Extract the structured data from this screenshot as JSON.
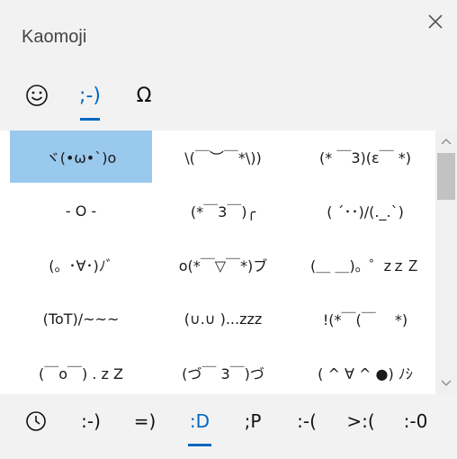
{
  "header": {
    "title": "Kaomoji",
    "close_icon": "close-icon"
  },
  "tabs": [
    {
      "icon": "smiley-icon",
      "label": "",
      "active": false
    },
    {
      "icon": "",
      "label": ";-)",
      "active": true
    },
    {
      "icon": "omega-symbol-icon",
      "label": "Ω",
      "active": false
    }
  ],
  "kaomoji_grid": [
    [
      "ヾ(•ω•`)o",
      "\\(￣︶￣*\\))",
      "(* ￣3)(ε￣ *)"
    ],
    [
      "- O -",
      "(*￣3￣)╭",
      "( ´･･)/(._.`)"
    ],
    [
      "(。･∀･)ﾉﾞ",
      "o(*￣▽￣*)ブ",
      "(＿ ＿)。゜zｚＺ"
    ],
    [
      "(ToT)/~~~",
      "(∪.∪ )...zzz",
      "!(*￣(￣ 　*)"
    ],
    [
      "(￣o￣) . z Z",
      "(づ￣ 3￣)づ",
      "( ^ ∀ ^ ●) ﾉｼ"
    ]
  ],
  "selected_cell": [
    0,
    0
  ],
  "scrollbar": {
    "up_icon": "chevron-up-icon",
    "down_icon": "chevron-down-icon"
  },
  "categories": [
    {
      "icon": "clock-icon",
      "label": "",
      "active": false
    },
    {
      "label": ":-)",
      "active": false
    },
    {
      "label": "=)",
      "active": false
    },
    {
      "label": ":D",
      "active": true
    },
    {
      "label": ";P",
      "active": false
    },
    {
      "label": ":-(",
      "active": false
    },
    {
      "label": ">:(",
      "active": false
    },
    {
      "label": ":-0",
      "active": false
    }
  ],
  "colors": {
    "accent": "#0067c0",
    "selected_bg": "#99c9ed"
  }
}
